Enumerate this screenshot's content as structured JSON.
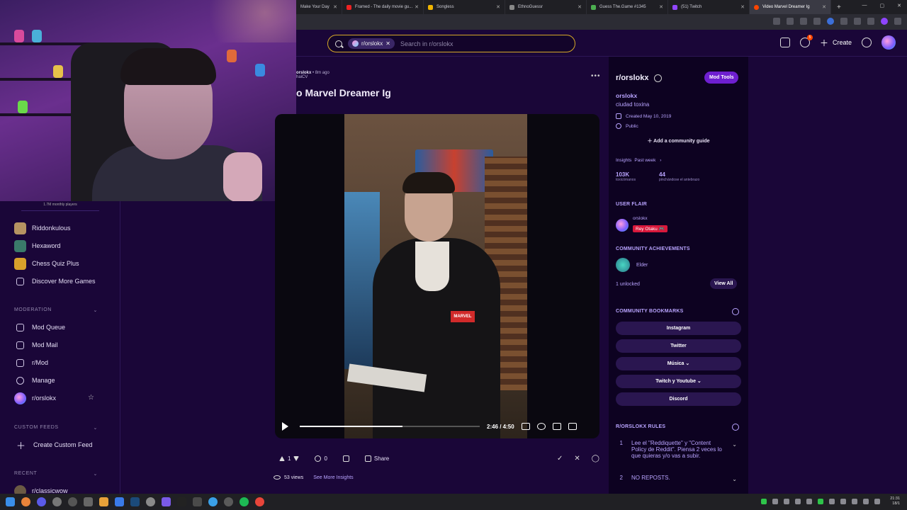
{
  "browser": {
    "tabs": [
      {
        "label": "Make Your Day",
        "color": "#444"
      },
      {
        "label": "Framed - The daily movie gu...",
        "color": "#e22"
      },
      {
        "label": "Songless",
        "color": "#f0b400"
      },
      {
        "label": "EthnoGuessr",
        "color": "#888"
      },
      {
        "label": "Guess The.Game #1345",
        "color": "#4caf50"
      },
      {
        "label": "(51) Twitch",
        "color": "#9146ff"
      },
      {
        "label": "Video Marvel Dreamer Ig",
        "color": "#ff4500"
      }
    ],
    "new_tab": "+",
    "window_controls": [
      "—",
      "▢",
      "✕"
    ]
  },
  "header": {
    "search_chip": "r/orslokx",
    "search_placeholder": "Search in r/orslokx",
    "create_label": "Create",
    "chat_badge": "5"
  },
  "sidebar": {
    "monthly_players": "1.7M monthly players",
    "games": [
      {
        "label": "Riddonkulous",
        "color": "#b69462"
      },
      {
        "label": "Hexaword",
        "color": "#3a7a6a"
      },
      {
        "label": "Chess Quiz Plus",
        "color": "#d8a12b"
      },
      {
        "label": "Discover More Games"
      }
    ],
    "moderation_header": "MODERATION",
    "moderation": [
      {
        "label": "Mod Queue"
      },
      {
        "label": "Mod Mail"
      },
      {
        "label": "r/Mod"
      },
      {
        "label": "Manage"
      },
      {
        "label": "r/orslokx"
      }
    ],
    "custom_feeds_header": "CUSTOM FEEDS",
    "create_custom_feed": "Create Custom Feed",
    "recent_header": "RECENT",
    "recent_item": "r/classicwow"
  },
  "post": {
    "author": "orslokx",
    "time": "• 8m ago",
    "flair": "haiCV",
    "title": "o Marvel Dreamer Ig",
    "shirt_logo": "MARVEL",
    "time_display": "2:46 / 4:50",
    "progress": 0.57,
    "upvotes": "1",
    "comments": "0",
    "share_label": "Share",
    "views": "53 views",
    "insights_link": "See More Insights"
  },
  "community": {
    "name": "r/orslokx",
    "mod_tools": "Mod Tools",
    "display_name": "orslokx",
    "description": "ciudad toxina",
    "created": "Created May 10, 2019",
    "visibility": "Public",
    "add_guide": "Add a community guide",
    "insights_label": "Insights",
    "insights_period": "Past week",
    "stat1_value": "103K",
    "stat1_label": "toxicómanos",
    "stat2_value": "44",
    "stat2_label": "pinchándose el antebrazo",
    "user_flair_header": "USER FLAIR",
    "flair_user": "orslokx",
    "flair_text": "Rey Otaku 🎮",
    "achievements_header": "COMMUNITY ACHIEVEMENTS",
    "achievement": "Elder",
    "unlocked": "1 unlocked",
    "view_all": "View All",
    "bookmarks_header": "COMMUNITY BOOKMARKS",
    "bookmarks": [
      "Instagram",
      "Twitter",
      "Música ⌄",
      "Twitch y Youtube ⌄",
      "Discord"
    ],
    "rules_header": "R/ORSLOKX RULES",
    "rules": [
      {
        "num": "1",
        "text": "Lee el \"Reddiquette\" y \"Content Policy de Reddit\". Piensa 2 veces lo que quieras y/o vas a subir."
      },
      {
        "num": "2",
        "text": "NO REPOSTS."
      }
    ]
  },
  "taskbar": {
    "time": "21:31",
    "date": "18/1"
  }
}
